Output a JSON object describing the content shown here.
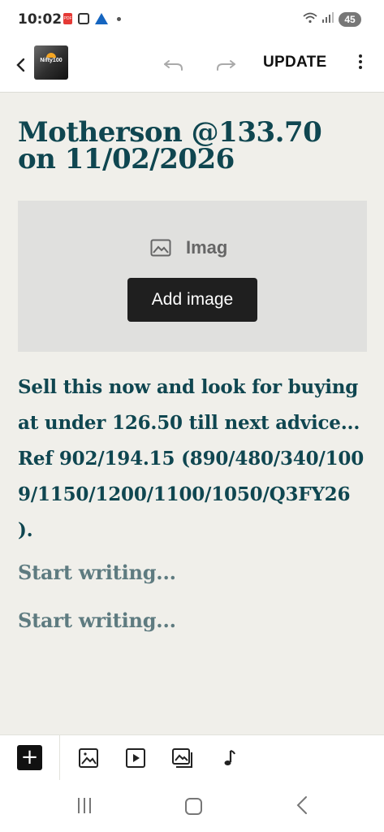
{
  "status_bar": {
    "time": "10:02",
    "left_icons": [
      "pdf-icon",
      "screenshot-icon",
      "triangle-app-icon",
      "notification-dot"
    ],
    "right_icons": [
      "wifi-icon",
      "signal-icon"
    ],
    "battery": "45"
  },
  "toolbar": {
    "logo_text": "Nifty100",
    "update_label": "UPDATE",
    "icons": [
      "back-arrow-icon",
      "undo-icon",
      "redo-icon",
      "more-vertical-icon"
    ]
  },
  "post": {
    "title": "Motherson @133.70 on 11/02/2026",
    "image_block": {
      "label": "Imag",
      "button_label": "Add image"
    },
    "body": "Sell this now and look for buying at under 126.50 till next advice... Ref 902/194.15 (890/480/340/1009/1150/1200/1100/1050/Q3FY26 ).",
    "placeholders": [
      "Start writing...",
      "Start writing..."
    ]
  },
  "bottom_toolbar": {
    "add_label": "+",
    "icons": [
      "image-icon",
      "video-icon",
      "gallery-icon",
      "music-note-icon"
    ]
  },
  "nav_bar": {
    "icons": [
      "recent-apps-icon",
      "home-icon",
      "nav-back-icon"
    ]
  },
  "colors": {
    "title_text": "#0f4650",
    "placeholder_text": "#5e7b80",
    "page_background": "#f0efea",
    "image_block_background": "#e0e0de",
    "button_background": "#1f1f1f"
  }
}
